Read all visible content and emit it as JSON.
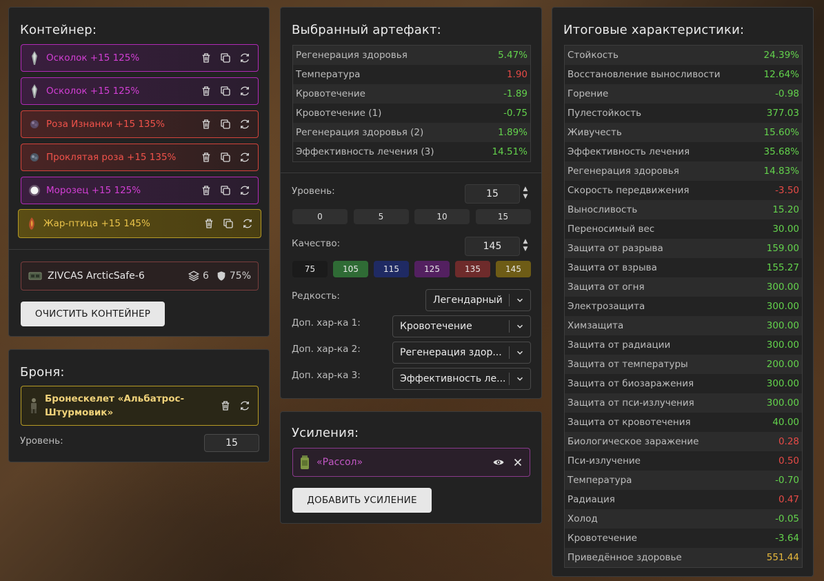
{
  "container": {
    "title": "Контейнер:",
    "items": [
      {
        "name": "Осколок +15 125%",
        "rarity": "purple"
      },
      {
        "name": "Осколок +15 125%",
        "rarity": "purple"
      },
      {
        "name": "Роза Изнанки +15 135%",
        "rarity": "red"
      },
      {
        "name": "Проклятая роза +15 135%",
        "rarity": "red"
      },
      {
        "name": "Морозец +15 125%",
        "rarity": "purple"
      },
      {
        "name": "Жар-птица +15 145%",
        "rarity": "gold"
      }
    ],
    "case": {
      "name": "ZIVCAS ArcticSafe-6",
      "slots": "6",
      "protection": "75%"
    },
    "clear_label": "ОЧИСТИТЬ КОНТЕЙНЕР"
  },
  "armor": {
    "title": "Броня:",
    "item_name": "Бронескелет «Альбатрос-Штурмовик»",
    "level_label": "Уровень:",
    "level_value": "15"
  },
  "artifact": {
    "title": "Выбранный артефакт:",
    "stats": [
      {
        "label": "Регенерация здоровья",
        "value": "5.47%",
        "sign": "pos"
      },
      {
        "label": "Температура",
        "value": "1.90",
        "sign": "neg"
      },
      {
        "label": "Кровотечение",
        "value": "-1.89",
        "sign": "pos"
      },
      {
        "label": "Кровотечение (1)",
        "value": "-0.75",
        "sign": "pos"
      },
      {
        "label": "Регенерация здоровья (2)",
        "value": "1.89%",
        "sign": "pos"
      },
      {
        "label": "Эффективность лечения (3)",
        "value": "14.51%",
        "sign": "pos"
      }
    ],
    "level_label": "Уровень:",
    "level_value": "15",
    "level_steps": [
      "0",
      "5",
      "10",
      "15"
    ],
    "quality_label": "Качество:",
    "quality_value": "145",
    "quality_steps": [
      {
        "label": "75",
        "color": "#1b1b1b"
      },
      {
        "label": "105",
        "color": "#2f6b35"
      },
      {
        "label": "115",
        "color": "#1f2a63"
      },
      {
        "label": "125",
        "color": "#532060"
      },
      {
        "label": "135",
        "color": "#6e2b2b"
      },
      {
        "label": "145",
        "color": "#6e5c16"
      }
    ],
    "rarity_label": "Редкость:",
    "rarity_value": "Легендарный",
    "extra1_label": "Доп. хар-ка 1:",
    "extra1_value": "Кровотечение",
    "extra2_label": "Доп. хар-ка 2:",
    "extra2_value": "Регенерация здор...",
    "extra3_label": "Доп. хар-ка 3:",
    "extra3_value": "Эффективность ле..."
  },
  "boosts": {
    "title": "Усиления:",
    "item_name": "«Рассол»",
    "add_label": "ДОБАВИТЬ УСИЛЕНИЕ"
  },
  "totals": {
    "title": "Итоговые характеристики:",
    "stats": [
      {
        "label": "Стойкость",
        "value": "24.39%",
        "sign": "pos"
      },
      {
        "label": "Восстановление выносливости",
        "value": "12.64%",
        "sign": "pos"
      },
      {
        "label": "Горение",
        "value": "-0.98",
        "sign": "pos"
      },
      {
        "label": "Пулестойкость",
        "value": "377.03",
        "sign": "pos"
      },
      {
        "label": "Живучесть",
        "value": "15.60%",
        "sign": "pos"
      },
      {
        "label": "Эффективность лечения",
        "value": "35.68%",
        "sign": "pos"
      },
      {
        "label": "Регенерация здоровья",
        "value": "14.83%",
        "sign": "pos"
      },
      {
        "label": "Скорость передвижения",
        "value": "-3.50",
        "sign": "neg"
      },
      {
        "label": "Выносливость",
        "value": "15.20",
        "sign": "pos"
      },
      {
        "label": "Переносимый вес",
        "value": "30.00",
        "sign": "pos"
      },
      {
        "label": "Защита от разрыва",
        "value": "159.00",
        "sign": "pos"
      },
      {
        "label": "Защита от взрыва",
        "value": "155.27",
        "sign": "pos"
      },
      {
        "label": "Защита от огня",
        "value": "300.00",
        "sign": "pos"
      },
      {
        "label": "Электрозащита",
        "value": "300.00",
        "sign": "pos"
      },
      {
        "label": "Химзащита",
        "value": "300.00",
        "sign": "pos"
      },
      {
        "label": "Защита от радиации",
        "value": "300.00",
        "sign": "pos"
      },
      {
        "label": "Защита от температуры",
        "value": "200.00",
        "sign": "pos"
      },
      {
        "label": "Защита от биозаражения",
        "value": "300.00",
        "sign": "pos"
      },
      {
        "label": "Защита от пси-излучения",
        "value": "300.00",
        "sign": "pos"
      },
      {
        "label": "Защита от кровотечения",
        "value": "40.00",
        "sign": "pos"
      },
      {
        "label": "Биологическое заражение",
        "value": "0.28",
        "sign": "neg"
      },
      {
        "label": "Пси-излучение",
        "value": "0.50",
        "sign": "neg"
      },
      {
        "label": "Температура",
        "value": "-0.70",
        "sign": "pos"
      },
      {
        "label": "Радиация",
        "value": "0.47",
        "sign": "neg"
      },
      {
        "label": "Холод",
        "value": "-0.05",
        "sign": "pos"
      },
      {
        "label": "Кровотечение",
        "value": "-3.64",
        "sign": "pos"
      },
      {
        "label": "Приведённое здоровье",
        "value": "551.44",
        "sign": "gold-val"
      }
    ]
  }
}
